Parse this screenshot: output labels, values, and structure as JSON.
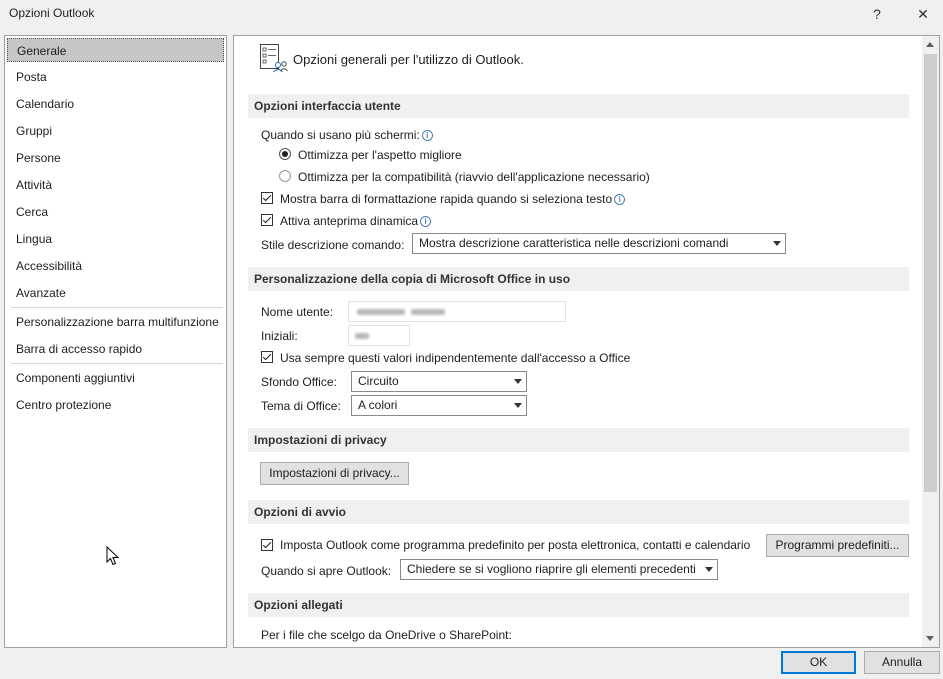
{
  "window": {
    "title": "Opzioni Outlook",
    "help_glyph": "?",
    "close_glyph": "✕"
  },
  "sidebar": {
    "items": [
      {
        "label": "Generale",
        "selected": true
      },
      {
        "label": "Posta"
      },
      {
        "label": "Calendario"
      },
      {
        "label": "Gruppi"
      },
      {
        "label": "Persone"
      },
      {
        "label": "Attività"
      },
      {
        "label": "Cerca"
      },
      {
        "label": "Lingua"
      },
      {
        "label": "Accessibilità"
      },
      {
        "label": "Avanzate"
      },
      {
        "label": "Personalizzazione barra multifunzione"
      },
      {
        "label": "Barra di accesso rapido"
      },
      {
        "label": "Componenti aggiuntivi"
      },
      {
        "label": "Centro protezione"
      }
    ]
  },
  "main": {
    "header": "Opzioni generali per l'utilizzo di Outlook.",
    "ui_options": {
      "title": "Opzioni interfaccia utente",
      "multi_screen_label": "Quando si usano più schermi:",
      "radio_appearance": "Ottimizza per l'aspetto migliore",
      "radio_compat": "Ottimizza per la compatibilità (riavvio dell'applicazione necessario)",
      "minitoolbar": "Mostra barra di formattazione rapida quando si seleziona testo",
      "live_preview": "Attiva anteprima dinamica",
      "tooltip_style_label": "Stile descrizione comando:",
      "tooltip_style_value": "Mostra descrizione caratteristica nelle descrizioni comandi"
    },
    "personalize": {
      "title": "Personalizzazione della copia di Microsoft Office in uso",
      "username_label": "Nome utente:",
      "initials_label": "Iniziali:",
      "always_use": "Usa sempre questi valori indipendentemente dall'accesso a Office",
      "background_label": "Sfondo Office:",
      "background_value": "Circuito",
      "theme_label": "Tema di Office:",
      "theme_value": "A colori"
    },
    "privacy": {
      "title": "Impostazioni di privacy",
      "button": "Impostazioni di privacy..."
    },
    "startup": {
      "title": "Opzioni di avvio",
      "default_program": "Imposta Outlook come programma predefinito per posta elettronica, contatti e calendario",
      "default_programs_button": "Programmi predefiniti...",
      "when_opens_label": "Quando si apre Outlook:",
      "when_opens_value": "Chiedere se si vogliono riaprire gli elementi precedenti"
    },
    "attachments": {
      "title": "Opzioni allegati",
      "onedrive_label": "Per i file che scelgo da OneDrive o SharePoint:"
    }
  },
  "footer": {
    "ok": "OK",
    "cancel": "Annulla"
  }
}
